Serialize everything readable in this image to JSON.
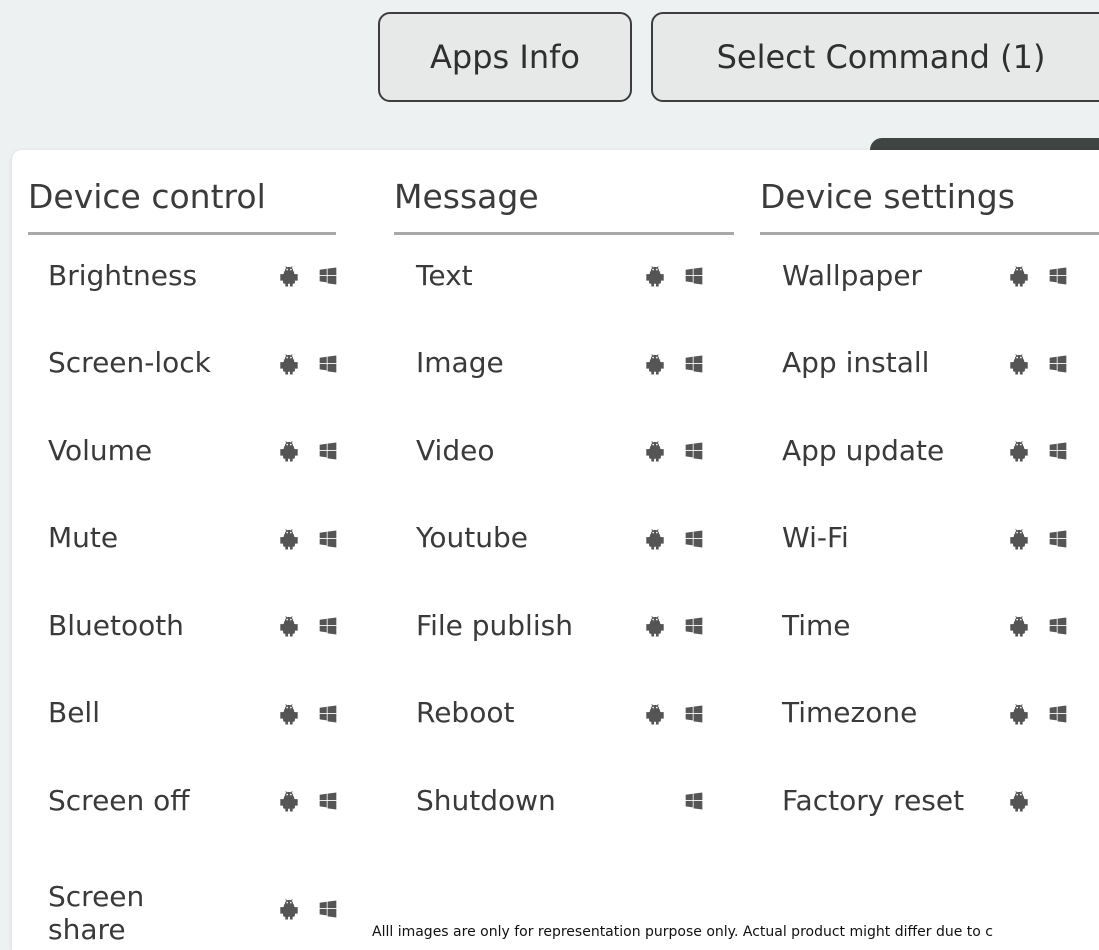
{
  "top_buttons": {
    "apps_info": "Apps Info",
    "select_command": "Select Command (1)"
  },
  "columns": [
    {
      "heading": "Device control",
      "items": [
        {
          "label": "Brightness",
          "android": true,
          "windows": true
        },
        {
          "label": "Screen-lock",
          "android": true,
          "windows": true
        },
        {
          "label": "Volume",
          "android": true,
          "windows": true
        },
        {
          "label": "Mute",
          "android": true,
          "windows": true
        },
        {
          "label": "Bluetooth",
          "android": true,
          "windows": true
        },
        {
          "label": "Bell",
          "android": true,
          "windows": true
        },
        {
          "label": "Screen off",
          "android": true,
          "windows": true
        },
        {
          "label": "Screen\nshare",
          "android": true,
          "windows": true
        }
      ]
    },
    {
      "heading": "Message",
      "items": [
        {
          "label": "Text",
          "android": true,
          "windows": true
        },
        {
          "label": "Image",
          "android": true,
          "windows": true
        },
        {
          "label": "Video",
          "android": true,
          "windows": true
        },
        {
          "label": "Youtube",
          "android": true,
          "windows": true
        },
        {
          "label": "File publish",
          "android": true,
          "windows": true
        },
        {
          "label": "Reboot",
          "android": true,
          "windows": true
        },
        {
          "label": "Shutdown",
          "android": false,
          "windows": true
        }
      ]
    },
    {
      "heading": "Device settings",
      "items": [
        {
          "label": "Wallpaper",
          "android": true,
          "windows": true
        },
        {
          "label": "App install",
          "android": true,
          "windows": true
        },
        {
          "label": "App update",
          "android": true,
          "windows": true
        },
        {
          "label": "Wi-Fi",
          "android": true,
          "windows": true
        },
        {
          "label": "Time",
          "android": true,
          "windows": true
        },
        {
          "label": "Timezone",
          "android": true,
          "windows": true
        },
        {
          "label": "Factory reset",
          "android": true,
          "windows": false
        }
      ]
    }
  ],
  "footnote": "Alll images are only for representation purpose only. Actual product might differ due to c",
  "colors": {
    "background": "#eef1f2",
    "panel": "#ffffff",
    "text": "#3a3a3a",
    "icon": "#555555",
    "border": "#3d3d3d"
  },
  "icons": {
    "android": "android-icon",
    "windows": "windows-icon"
  }
}
